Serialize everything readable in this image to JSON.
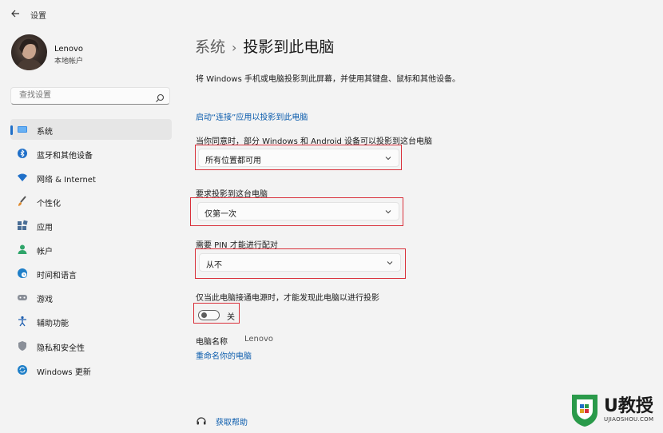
{
  "window": {
    "title": "设置"
  },
  "profile": {
    "name": "Lenovo",
    "account_type": "本地帐户"
  },
  "search": {
    "placeholder": "查找设置"
  },
  "sidebar": {
    "items": [
      {
        "label": "系统",
        "icon": "monitor-icon",
        "active": true
      },
      {
        "label": "蓝牙和其他设备",
        "icon": "bluetooth-icon"
      },
      {
        "label": "网络 & Internet",
        "icon": "wifi-icon"
      },
      {
        "label": "个性化",
        "icon": "brush-icon"
      },
      {
        "label": "应用",
        "icon": "apps-icon"
      },
      {
        "label": "帐户",
        "icon": "person-icon"
      },
      {
        "label": "时间和语言",
        "icon": "globe-clock-icon"
      },
      {
        "label": "游戏",
        "icon": "gamepad-icon"
      },
      {
        "label": "辅助功能",
        "icon": "accessibility-icon"
      },
      {
        "label": "隐私和安全性",
        "icon": "shield-icon"
      },
      {
        "label": "Windows 更新",
        "icon": "update-icon"
      }
    ]
  },
  "breadcrumb": {
    "parent": "系统",
    "separator": "›",
    "current": "投影到此电脑"
  },
  "main": {
    "description": "将 Windows 手机或电脑投影到此屏幕，并使用其键盘、鼠标和其他设备。",
    "launch_link": "启动“连接”应用以投影到此电脑",
    "availability": {
      "label": "当你同意时，部分 Windows 和 Android 设备可以投影到这台电脑",
      "value": "所有位置都可用"
    },
    "ask_projection": {
      "label": "要求投影到这台电脑",
      "value": "仅第一次"
    },
    "require_pin": {
      "label": "需要 PIN 才能进行配对",
      "value": "从不"
    },
    "power_only": {
      "label": "仅当此电脑接通电源时，才能发现此电脑以进行投影",
      "toggle_label": "关",
      "toggle_on": false
    },
    "pc_name": {
      "label": "电脑名称",
      "value": "Lenovo",
      "rename_link": "重命名你的电脑"
    },
    "help_link": "获取帮助"
  },
  "watermark": {
    "brand": "U教授",
    "url": "UJIAOSHOU.COM"
  },
  "colors": {
    "accent": "#1f6fc8",
    "link": "#0b5cad",
    "highlight": "#d9303a"
  }
}
